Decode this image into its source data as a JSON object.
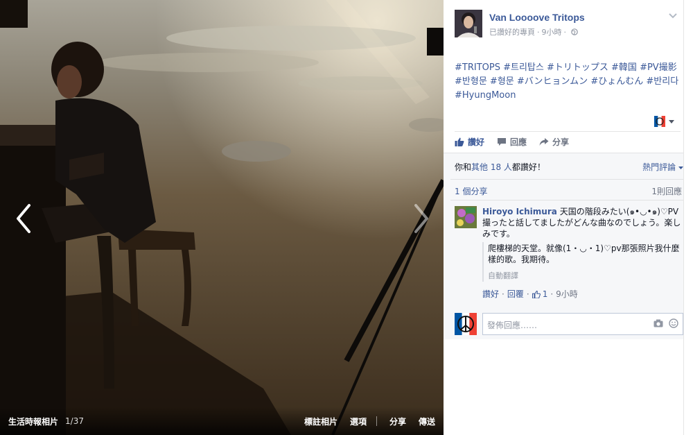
{
  "viewer": {
    "album_name": "生活時報相片",
    "album_count": "1/37",
    "actions": {
      "tag": "標註相片",
      "options": "選項",
      "share": "分享",
      "send": "傳送"
    }
  },
  "post": {
    "page_name": "Van Loooove Tritops",
    "meta_status": "已讚好的專頁",
    "meta_dot": "·",
    "time": "9小時",
    "hashtags": [
      "#TRITOPS",
      "#트리탑스",
      "#トリトップス",
      "#韓国",
      "#PV撮影",
      "#반형문",
      "#형문",
      "#バンヒョンムン",
      "#ひょんむん",
      "#반리다",
      "#HyungMoon"
    ],
    "actions": {
      "like": "讚好",
      "comment": "回應",
      "share": "分享"
    }
  },
  "ufi": {
    "likes_prefix": "你和",
    "likes_link": "其他 18 人",
    "likes_suffix": "都讚好！",
    "sort": "熱門評論",
    "shares": "1 個分享",
    "replies": "1則回應",
    "comment": {
      "author": "Hiroyo Ichimura",
      "text": "天国の階段みたい(๑•◡•๑)♡PV撮ったと話してましたがどんな曲なのでしょう。楽しみです。",
      "translation": "爬樓梯的天堂。就像(1・◡・1)♡pv那張照片我什麼樣的歌。我期待。",
      "auto_translated": "自動翻譯",
      "like": "讚好",
      "reply": "回覆",
      "like_count": "1",
      "time": "9小時"
    },
    "composer_placeholder": "發佈回應……"
  },
  "colors": {
    "facebook_blue": "#3b5998",
    "muted_grey": "#9197a3"
  }
}
